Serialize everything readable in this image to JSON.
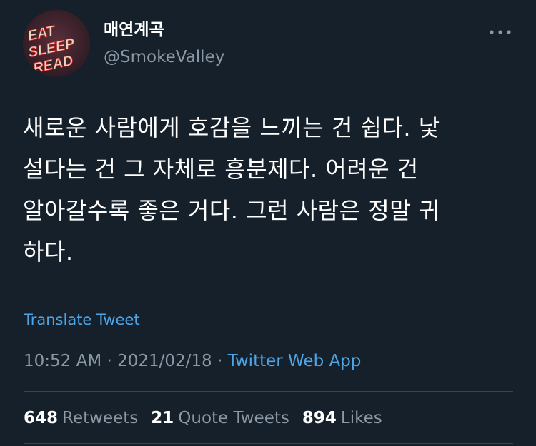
{
  "tweet": {
    "display_name": "매연계곡",
    "handle": "@SmokeValley",
    "avatar_text": [
      "EAT",
      "SLEEP",
      "READ"
    ],
    "text_lines": [
      "새로운 사람에게 호감을 느끼는 건 쉽다. 낯",
      "설다는 건 그 자체로 흥분제다. 어려운 건",
      "알아갈수록 좋은 거다. 그런 사람은 정말 귀",
      "하다."
    ],
    "translate_label": "Translate Tweet",
    "time": "10:52 AM",
    "separator": "·",
    "date": "2021/02/18",
    "source": "Twitter Web App",
    "more_icon": "more-dots-icon"
  },
  "stats": {
    "retweets_count": "648",
    "retweets_label": "Retweets",
    "quotes_count": "21",
    "quotes_label": "Quote Tweets",
    "likes_count": "894",
    "likes_label": "Likes"
  },
  "colors": {
    "background": "#15202b",
    "accent": "#4ea5e6",
    "secondary_text": "#8b98a5"
  }
}
